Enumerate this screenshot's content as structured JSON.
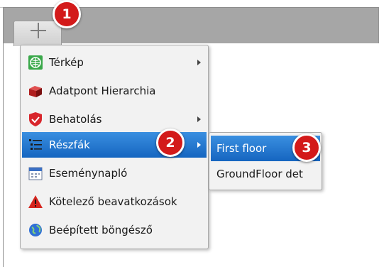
{
  "menu": {
    "items": [
      {
        "label": "Térkép",
        "icon": "map-globe-icon",
        "has_submenu": true
      },
      {
        "label": "Adatpont Hierarchia",
        "icon": "cube-stack-icon",
        "has_submenu": false
      },
      {
        "label": "Behatolás",
        "icon": "shield-icon",
        "has_submenu": true
      },
      {
        "label": "Részfák",
        "icon": "tree-list-icon",
        "has_submenu": true,
        "active": true
      },
      {
        "label": "Eseménynapló",
        "icon": "calendar-icon",
        "has_submenu": false
      },
      {
        "label": "Kötelező beavatkozások",
        "icon": "warning-triangle-icon",
        "has_submenu": false
      },
      {
        "label": "Beépített böngésző",
        "icon": "globe-icon",
        "has_submenu": false
      }
    ]
  },
  "submenu": {
    "items": [
      {
        "label": "First floor",
        "active": true
      },
      {
        "label": "GroundFloor det",
        "active": false
      }
    ]
  },
  "badges": [
    "1",
    "2",
    "3"
  ],
  "colors": {
    "highlight_top": "#3a8fe0",
    "highlight_bottom": "#1565c0",
    "badge": "#d31a1a",
    "tab_strip": "#a6a6a6"
  }
}
